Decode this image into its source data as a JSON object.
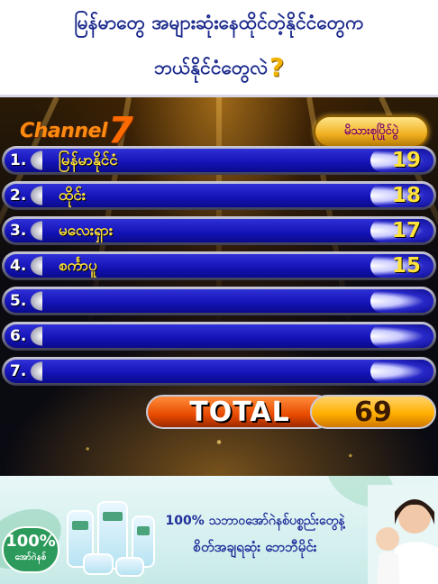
{
  "question": {
    "line1": "မြန်မာတွေ အများဆုံးနေထိုင်တဲ့နိုင်ငံတွေက",
    "line2": "ဘယ်နိုင်ငံတွေလဲ",
    "mark": "?"
  },
  "branding": {
    "channel_text": "Channel",
    "channel_num": "7",
    "show_logo": "မိသားစုပြိုင်ပွဲ",
    "stars": "★★★★★"
  },
  "answers": [
    {
      "num": "1.",
      "answer": "မြန်မာနိုင်ငံ",
      "score": "19"
    },
    {
      "num": "2.",
      "answer": "ထိုင်း",
      "score": "18"
    },
    {
      "num": "3.",
      "answer": "မလေးရှား",
      "score": "17"
    },
    {
      "num": "4.",
      "answer": "စင်္ကာပူ",
      "score": "15"
    },
    {
      "num": "5.",
      "answer": "",
      "score": ""
    },
    {
      "num": "6.",
      "answer": "",
      "score": ""
    },
    {
      "num": "7.",
      "answer": "",
      "score": ""
    }
  ],
  "total": {
    "label": "TOTAL",
    "value": "69"
  },
  "ad": {
    "badge_big": "100%",
    "badge_small": "အော်ဂဲနစ်",
    "line1": "100% သဘာဝအော်ဂဲနစ်ပစ္စည်းတွေနဲ့",
    "line2": "စိတ်အချရဆုံး ဘေဘီမိုင်း"
  },
  "colors": {
    "row_blue": "#1414b8",
    "answer_yellow": "#ffe23a",
    "total_orange": "#e84a00",
    "total_gold": "#ffb000",
    "header_text": "#1b2a8c"
  }
}
